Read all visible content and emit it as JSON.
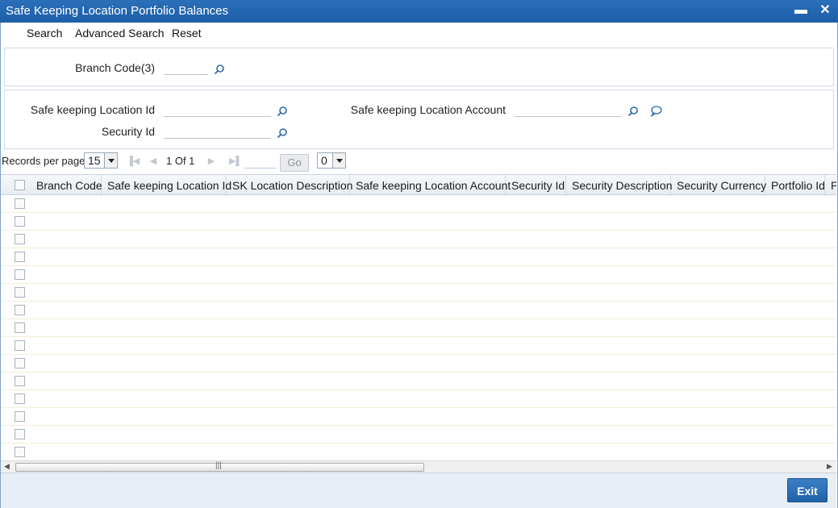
{
  "window": {
    "title": "Safe Keeping Location Portfolio Balances",
    "minimize": "▬",
    "close": "✕"
  },
  "menu": {
    "search": "Search",
    "advanced_search": "Advanced Search",
    "reset": "Reset"
  },
  "form": {
    "branch_code_label": "Branch Code(3)",
    "branch_code_value": "",
    "sk_location_id_label": "Safe keeping Location Id",
    "sk_location_id_value": "",
    "security_id_label": "Security Id",
    "security_id_value": "",
    "sk_location_account_label": "Safe keeping Location Account",
    "sk_location_account_value": ""
  },
  "pager": {
    "records_per_page_label": "Records per page",
    "records_per_page_value": "15",
    "page_info": "1 Of 1",
    "go_label": "Go",
    "page_select_value": "0"
  },
  "grid": {
    "columns": [
      "Branch Code",
      "Safe keeping Location Id",
      "SK Location Description",
      "Safe keeping Location Account",
      "Security Id",
      "Security Description",
      "Security Currency",
      "Portfolio Id",
      "P"
    ],
    "row_count": 15
  },
  "footer": {
    "exit_label": "Exit"
  },
  "colors": {
    "titlebar": "#1d5ea8",
    "accent": "#2a6fb8",
    "row_line": "#f1eed5"
  }
}
